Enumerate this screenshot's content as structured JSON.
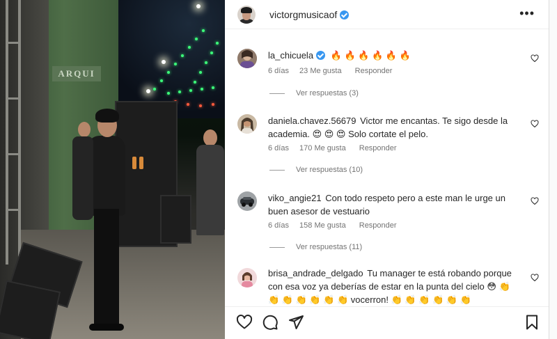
{
  "post": {
    "author": "victorgmusicaof",
    "author_verified": true,
    "more_icon": "more-horizontal-icon",
    "photo_sign_text": "ARQUI"
  },
  "comments": [
    {
      "username": "la_chicuela",
      "verified": true,
      "text": "🔥 🔥 🔥 🔥 🔥 🔥",
      "age": "6 días",
      "likes": "23 Me gusta",
      "reply": "Responder",
      "view_replies": "Ver respuestas (3)"
    },
    {
      "username": "daniela.chavez.56679",
      "verified": false,
      "text": "Victor me encantas. Te sigo desde la academia. 😍 😍 😍  Solo cortate el pelo.",
      "age": "6 días",
      "likes": "170 Me gusta",
      "reply": "Responder",
      "view_replies": "Ver respuestas (10)"
    },
    {
      "username": "viko_angie21",
      "verified": false,
      "text": "Con todo respeto pero a este man le urge un buen asesor de vestuario",
      "age": "6 días",
      "likes": "158 Me gusta",
      "reply": "Responder",
      "view_replies": "Ver respuestas (11)"
    },
    {
      "username": "brisa_andrade_delgado",
      "verified": false,
      "text": "Tu manager te está robando porque con esa voz ya deberías de estar en la punta del cielo 😳 👏 👏 👏 👏 👏 👏 👏 vocerron! 👏 👏 👏 👏 👏 👏"
    }
  ],
  "actions": {
    "like_icon": "heart-icon",
    "comment_icon": "comment-icon",
    "share_icon": "share-icon",
    "save_icon": "bookmark-icon"
  },
  "colors": {
    "text": "#262626",
    "meta": "#737373",
    "verified": "#3897f0"
  }
}
